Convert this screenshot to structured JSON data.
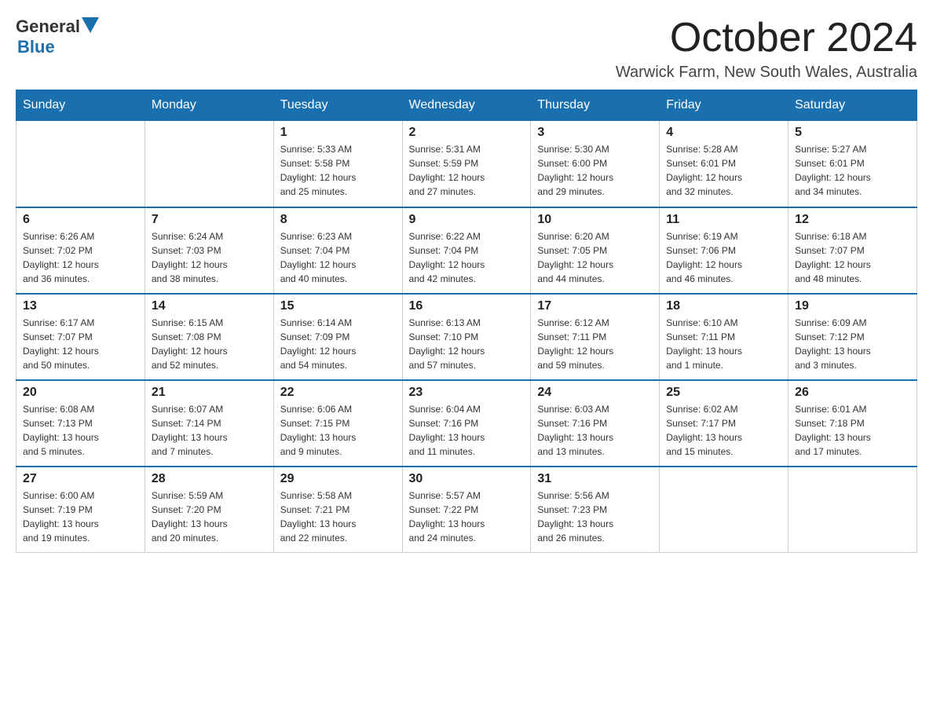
{
  "logo": {
    "general": "General",
    "blue": "Blue"
  },
  "header": {
    "month_year": "October 2024",
    "location": "Warwick Farm, New South Wales, Australia"
  },
  "weekdays": [
    "Sunday",
    "Monday",
    "Tuesday",
    "Wednesday",
    "Thursday",
    "Friday",
    "Saturday"
  ],
  "weeks": [
    [
      {
        "day": "",
        "info": ""
      },
      {
        "day": "",
        "info": ""
      },
      {
        "day": "1",
        "info": "Sunrise: 5:33 AM\nSunset: 5:58 PM\nDaylight: 12 hours\nand 25 minutes."
      },
      {
        "day": "2",
        "info": "Sunrise: 5:31 AM\nSunset: 5:59 PM\nDaylight: 12 hours\nand 27 minutes."
      },
      {
        "day": "3",
        "info": "Sunrise: 5:30 AM\nSunset: 6:00 PM\nDaylight: 12 hours\nand 29 minutes."
      },
      {
        "day": "4",
        "info": "Sunrise: 5:28 AM\nSunset: 6:01 PM\nDaylight: 12 hours\nand 32 minutes."
      },
      {
        "day": "5",
        "info": "Sunrise: 5:27 AM\nSunset: 6:01 PM\nDaylight: 12 hours\nand 34 minutes."
      }
    ],
    [
      {
        "day": "6",
        "info": "Sunrise: 6:26 AM\nSunset: 7:02 PM\nDaylight: 12 hours\nand 36 minutes."
      },
      {
        "day": "7",
        "info": "Sunrise: 6:24 AM\nSunset: 7:03 PM\nDaylight: 12 hours\nand 38 minutes."
      },
      {
        "day": "8",
        "info": "Sunrise: 6:23 AM\nSunset: 7:04 PM\nDaylight: 12 hours\nand 40 minutes."
      },
      {
        "day": "9",
        "info": "Sunrise: 6:22 AM\nSunset: 7:04 PM\nDaylight: 12 hours\nand 42 minutes."
      },
      {
        "day": "10",
        "info": "Sunrise: 6:20 AM\nSunset: 7:05 PM\nDaylight: 12 hours\nand 44 minutes."
      },
      {
        "day": "11",
        "info": "Sunrise: 6:19 AM\nSunset: 7:06 PM\nDaylight: 12 hours\nand 46 minutes."
      },
      {
        "day": "12",
        "info": "Sunrise: 6:18 AM\nSunset: 7:07 PM\nDaylight: 12 hours\nand 48 minutes."
      }
    ],
    [
      {
        "day": "13",
        "info": "Sunrise: 6:17 AM\nSunset: 7:07 PM\nDaylight: 12 hours\nand 50 minutes."
      },
      {
        "day": "14",
        "info": "Sunrise: 6:15 AM\nSunset: 7:08 PM\nDaylight: 12 hours\nand 52 minutes."
      },
      {
        "day": "15",
        "info": "Sunrise: 6:14 AM\nSunset: 7:09 PM\nDaylight: 12 hours\nand 54 minutes."
      },
      {
        "day": "16",
        "info": "Sunrise: 6:13 AM\nSunset: 7:10 PM\nDaylight: 12 hours\nand 57 minutes."
      },
      {
        "day": "17",
        "info": "Sunrise: 6:12 AM\nSunset: 7:11 PM\nDaylight: 12 hours\nand 59 minutes."
      },
      {
        "day": "18",
        "info": "Sunrise: 6:10 AM\nSunset: 7:11 PM\nDaylight: 13 hours\nand 1 minute."
      },
      {
        "day": "19",
        "info": "Sunrise: 6:09 AM\nSunset: 7:12 PM\nDaylight: 13 hours\nand 3 minutes."
      }
    ],
    [
      {
        "day": "20",
        "info": "Sunrise: 6:08 AM\nSunset: 7:13 PM\nDaylight: 13 hours\nand 5 minutes."
      },
      {
        "day": "21",
        "info": "Sunrise: 6:07 AM\nSunset: 7:14 PM\nDaylight: 13 hours\nand 7 minutes."
      },
      {
        "day": "22",
        "info": "Sunrise: 6:06 AM\nSunset: 7:15 PM\nDaylight: 13 hours\nand 9 minutes."
      },
      {
        "day": "23",
        "info": "Sunrise: 6:04 AM\nSunset: 7:16 PM\nDaylight: 13 hours\nand 11 minutes."
      },
      {
        "day": "24",
        "info": "Sunrise: 6:03 AM\nSunset: 7:16 PM\nDaylight: 13 hours\nand 13 minutes."
      },
      {
        "day": "25",
        "info": "Sunrise: 6:02 AM\nSunset: 7:17 PM\nDaylight: 13 hours\nand 15 minutes."
      },
      {
        "day": "26",
        "info": "Sunrise: 6:01 AM\nSunset: 7:18 PM\nDaylight: 13 hours\nand 17 minutes."
      }
    ],
    [
      {
        "day": "27",
        "info": "Sunrise: 6:00 AM\nSunset: 7:19 PM\nDaylight: 13 hours\nand 19 minutes."
      },
      {
        "day": "28",
        "info": "Sunrise: 5:59 AM\nSunset: 7:20 PM\nDaylight: 13 hours\nand 20 minutes."
      },
      {
        "day": "29",
        "info": "Sunrise: 5:58 AM\nSunset: 7:21 PM\nDaylight: 13 hours\nand 22 minutes."
      },
      {
        "day": "30",
        "info": "Sunrise: 5:57 AM\nSunset: 7:22 PM\nDaylight: 13 hours\nand 24 minutes."
      },
      {
        "day": "31",
        "info": "Sunrise: 5:56 AM\nSunset: 7:23 PM\nDaylight: 13 hours\nand 26 minutes."
      },
      {
        "day": "",
        "info": ""
      },
      {
        "day": "",
        "info": ""
      }
    ]
  ]
}
